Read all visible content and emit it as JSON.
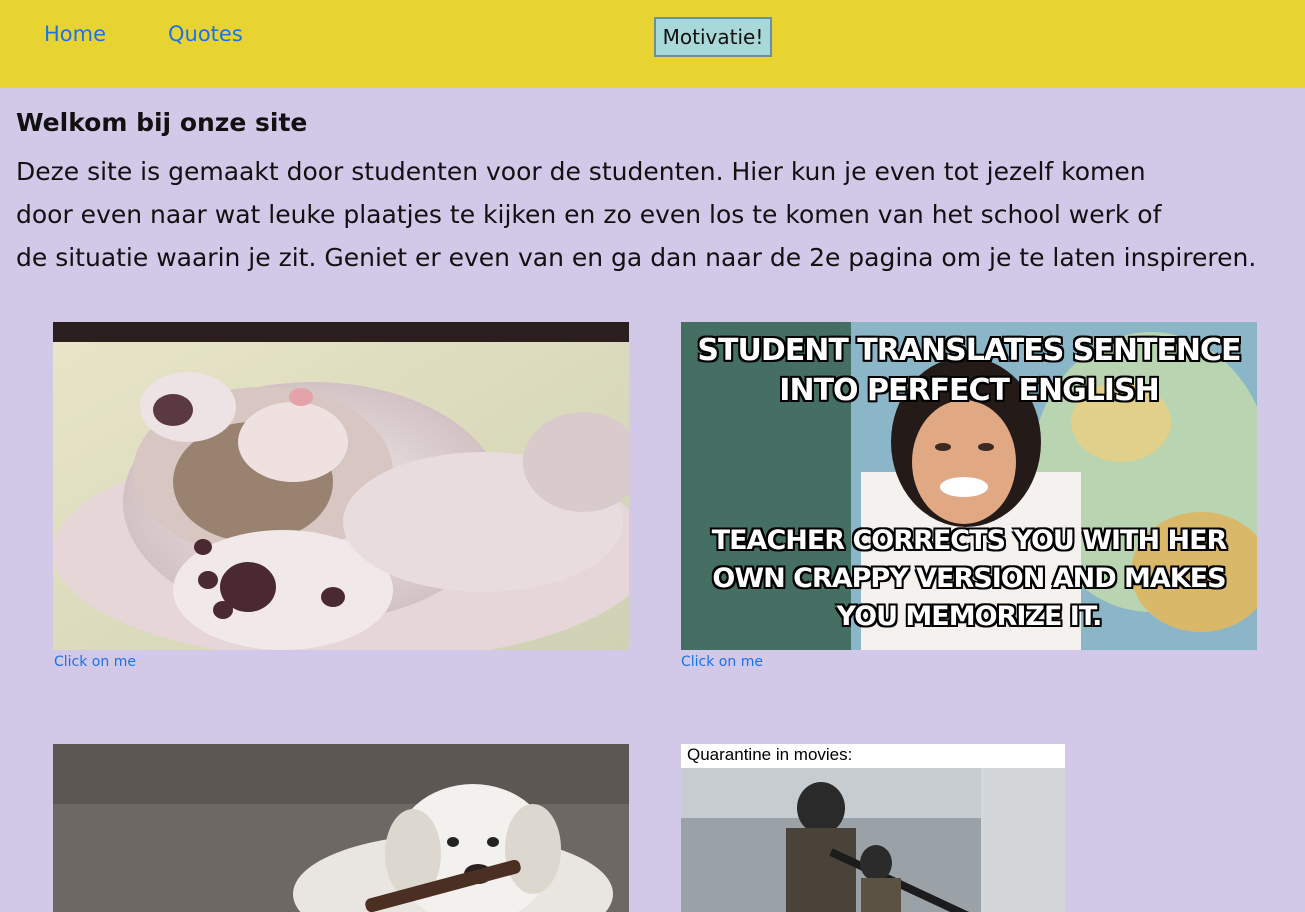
{
  "nav": {
    "home_label": "Home",
    "quotes_label": "Quotes",
    "motivation_button": "Motivatie!"
  },
  "intro": {
    "heading": "Welkom bij onze site",
    "line1": "Deze site is gemaakt door studenten voor de studenten. Hier kun je even tot jezelf komen",
    "line2": "door even naar wat leuke plaatjes te kijken en zo even los te komen van het school werk of",
    "line3": "de situatie waarin je zit. Geniet er even van en ga dan naar de 2e pagina om je te laten inspireren."
  },
  "gallery": {
    "kitten_caption": "Click on me",
    "meme_top": "STUDENT TRANSLATES SENTENCE",
    "meme_top2": "INTO PERFECT ENGLISH",
    "meme_bottom1": "TEACHER CORRECTS YOU WITH HER",
    "meme_bottom2": "OWN CRAPPY VERSION AND MAKES",
    "meme_bottom3": "YOU MEMORIZE IT.",
    "meme_caption": "Click on me",
    "quarantine_title": "Quarantine in movies:"
  },
  "colors": {
    "header_bg": "#e7d433",
    "page_bg": "#d2c8e8",
    "link": "#1a73e8",
    "button_bg": "#a8d8d8"
  }
}
